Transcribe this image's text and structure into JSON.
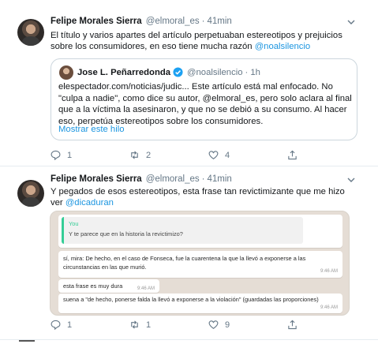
{
  "tweet1": {
    "name": "Felipe Morales Sierra",
    "handle": "@elmoral_es",
    "separator": "·",
    "time": "41min",
    "text_line1": "El título y varios apartes del artículo perpetuaban estereotipos y prejuicios",
    "text_line2_prefix": "sobre los consumidores, en eso tiene mucha razón ",
    "text_mention": "@noalsilencio",
    "quote": {
      "name": "Jose L. Peñarredonda",
      "handle": "@noalsilencio",
      "separator": "·",
      "time": "1h",
      "text": "elespectador.com/noticias/judic... Este artículo está mal enfocado. No \"culpa a nadie\", como dice su autor, @elmoral_es, pero solo aclara al final que a la víctima la asesinaron, y que no se debió a su consumo. Al hacer eso, perpetúa estereotipos sobre los consumidores.",
      "show_thread": "Mostrar este hilo"
    },
    "actions": {
      "replies": "1",
      "retweets": "2",
      "likes": "4"
    }
  },
  "tweet2": {
    "name": "Felipe Morales Sierra",
    "handle": "@elmoral_es",
    "separator": "·",
    "time": "41min",
    "text_line1": "Y pegados de esos estereotipos, esta frase tan revictimizante que me hizo",
    "text_line2_prefix": "ver ",
    "text_mention": "@dicaduran",
    "chat": {
      "reply_author": "You",
      "reply_text": "Y te parece que en la historia la revictimizo?",
      "msg1": "sí, mira: De hecho, en el caso de Fonseca, fue la cuarentena la que la llevó a exponerse a las circunstancias en las que murió.",
      "msg1_time": "9:46 AM",
      "msg2": "esta frase es muy dura",
      "msg2_time": "9:46 AM",
      "msg3": "suena a \"de hecho, ponerse falda la llevó a exponerse a la violación\" (guardadas las proporciones)",
      "msg3_time": "9:46 AM"
    },
    "actions": {
      "replies": "1",
      "retweets": "1",
      "likes": "9"
    }
  },
  "colors": {
    "link": "#1b95e0",
    "muted": "#657786",
    "chat_bg": "#e5ddd5",
    "chat_accent": "#35cd96"
  }
}
